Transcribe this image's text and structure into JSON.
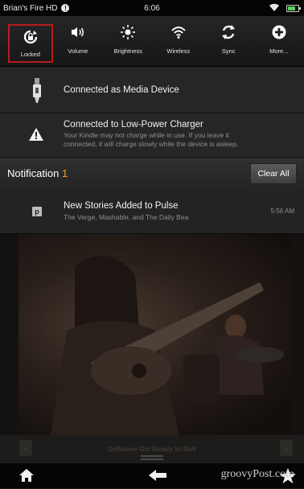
{
  "status_bar": {
    "device_name": "Brian's Fire HD",
    "alert_badge": "!",
    "time": "6:06"
  },
  "quick_settings": [
    {
      "label": "Locked",
      "icon": "rotation-lock-icon",
      "selected": true
    },
    {
      "label": "Volume",
      "icon": "volume-icon"
    },
    {
      "label": "Brightness",
      "icon": "brightness-icon"
    },
    {
      "label": "Wireless",
      "icon": "wifi-icon"
    },
    {
      "label": "Sync",
      "icon": "sync-icon"
    },
    {
      "label": "More...",
      "icon": "plus-icon"
    }
  ],
  "persistent": {
    "media": {
      "title": "Connected as Media Device",
      "icon": "usb-icon"
    },
    "charger": {
      "title": "Connected to Low-Power Charger",
      "line1": "Your Kindle may not charge while in use. If you leave it",
      "line2": "connected, it will charge slowly while the device is asleep.",
      "icon": "warning-icon"
    }
  },
  "notifications_header": {
    "label": "Notification",
    "count": "1",
    "clear_all": "Clear All",
    "count_color": "#f3a21b"
  },
  "story": {
    "icon_letter": "p",
    "title": "New Stories Added to Pulse",
    "subtitle": "The Verge, Mashable, and The Daily Bea",
    "time": "5:56 AM"
  },
  "background": {
    "caption": "Deftones Get Ready to Roll"
  },
  "bottom_nav": {
    "watermark": "groovyPost.com"
  },
  "colors": {
    "selected_outline": "#b71c1c",
    "accent": "#f3a21b"
  }
}
